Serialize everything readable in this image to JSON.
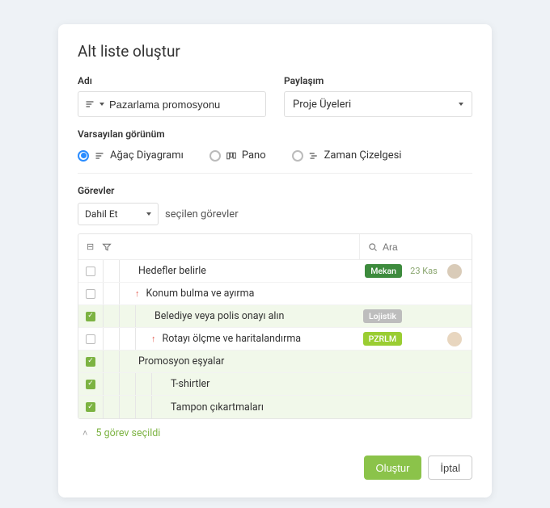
{
  "modal": {
    "title": "Alt liste oluştur",
    "name_label": "Adı",
    "name_value": "Pazarlama promosyonu",
    "share_label": "Paylaşım",
    "share_value": "Proje Üyeleri",
    "default_view_label": "Varsayılan görünüm",
    "views": {
      "tree": "Ağaç Diyagramı",
      "board": "Pano",
      "timeline": "Zaman Çizelgesi"
    },
    "tasks_label": "Görevler",
    "include_value": "Dahil Et",
    "include_suffix": "seçilen görevler",
    "search_placeholder": "Ara",
    "summary": "5 görev seçildi",
    "create_btn": "Oluştur",
    "cancel_btn": "İptal"
  },
  "tasks": [
    {
      "selected": false,
      "indent": 2,
      "priority": false,
      "text": "Hedefler belirle",
      "badge": "Mekan",
      "badge_color": "green",
      "date": "23 Kas",
      "avatar": 1
    },
    {
      "selected": false,
      "indent": 2,
      "priority": true,
      "text": "Konum bulma ve ayırma",
      "badge": "",
      "badge_color": "",
      "date": "",
      "avatar": 0
    },
    {
      "selected": true,
      "indent": 3,
      "priority": false,
      "text": "Belediye veya polis onayı alın",
      "badge": "Lojistik",
      "badge_color": "gray",
      "date": "",
      "avatar": 0
    },
    {
      "selected": false,
      "indent": 3,
      "priority": true,
      "text": "Rotayı ölçme ve haritalandırma",
      "badge": "PZRLM",
      "badge_color": "lime",
      "date": "",
      "avatar": 2
    },
    {
      "selected": true,
      "indent": 2,
      "priority": false,
      "text": "Promosyon eşyalar",
      "badge": "",
      "badge_color": "",
      "date": "",
      "avatar": 0
    },
    {
      "selected": true,
      "indent": 4,
      "priority": false,
      "text": "T-shirtler",
      "badge": "",
      "badge_color": "",
      "date": "",
      "avatar": 0
    },
    {
      "selected": true,
      "indent": 4,
      "priority": false,
      "text": "Tampon çıkartmaları",
      "badge": "",
      "badge_color": "",
      "date": "",
      "avatar": 0
    }
  ]
}
